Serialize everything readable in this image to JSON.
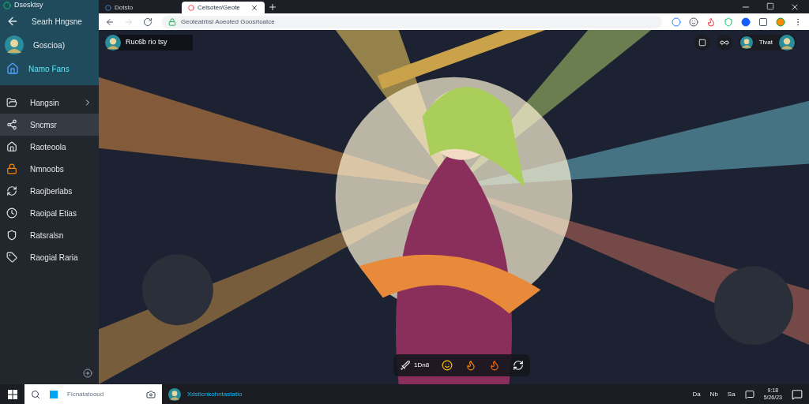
{
  "sidebar": {
    "header": "Dsesktsy",
    "back_label": "Searh Hngsne",
    "profile_name": "Goscioa)",
    "app_label": "Namo Fans",
    "items": [
      {
        "label": "Hangsin",
        "selected": false,
        "expandable": true
      },
      {
        "label": "Sncmsr",
        "selected": true,
        "expandable": false
      },
      {
        "label": "Raoteoola",
        "selected": false,
        "expandable": false
      },
      {
        "label": "Nmnoobs",
        "selected": false,
        "expandable": false
      },
      {
        "label": "Raojberlabs",
        "selected": false,
        "expandable": false
      },
      {
        "label": "Raoipal Etias",
        "selected": false,
        "expandable": false
      },
      {
        "label": "Ratsralsn",
        "selected": false,
        "expandable": false
      },
      {
        "label": "Raogial Raria",
        "selected": false,
        "expandable": false
      }
    ]
  },
  "browser": {
    "tabs": [
      {
        "label": "Dotsto",
        "selected": false
      },
      {
        "label": "Celsoter/Geote",
        "selected": true
      }
    ],
    "url": "Geoteatrbsl Aoeoted Goosrtoatce"
  },
  "viewer": {
    "channel": "Ruc6b rio tsy",
    "user": "Tlvat",
    "counter": "1Dn8"
  },
  "taskbar": {
    "search_placeholder": "Ficnatatooud",
    "app_label": "Xdsticnkohntastatio",
    "tray": [
      "Da",
      "Nb",
      "Sa"
    ],
    "time": "9:18",
    "date": "5/26/23"
  }
}
